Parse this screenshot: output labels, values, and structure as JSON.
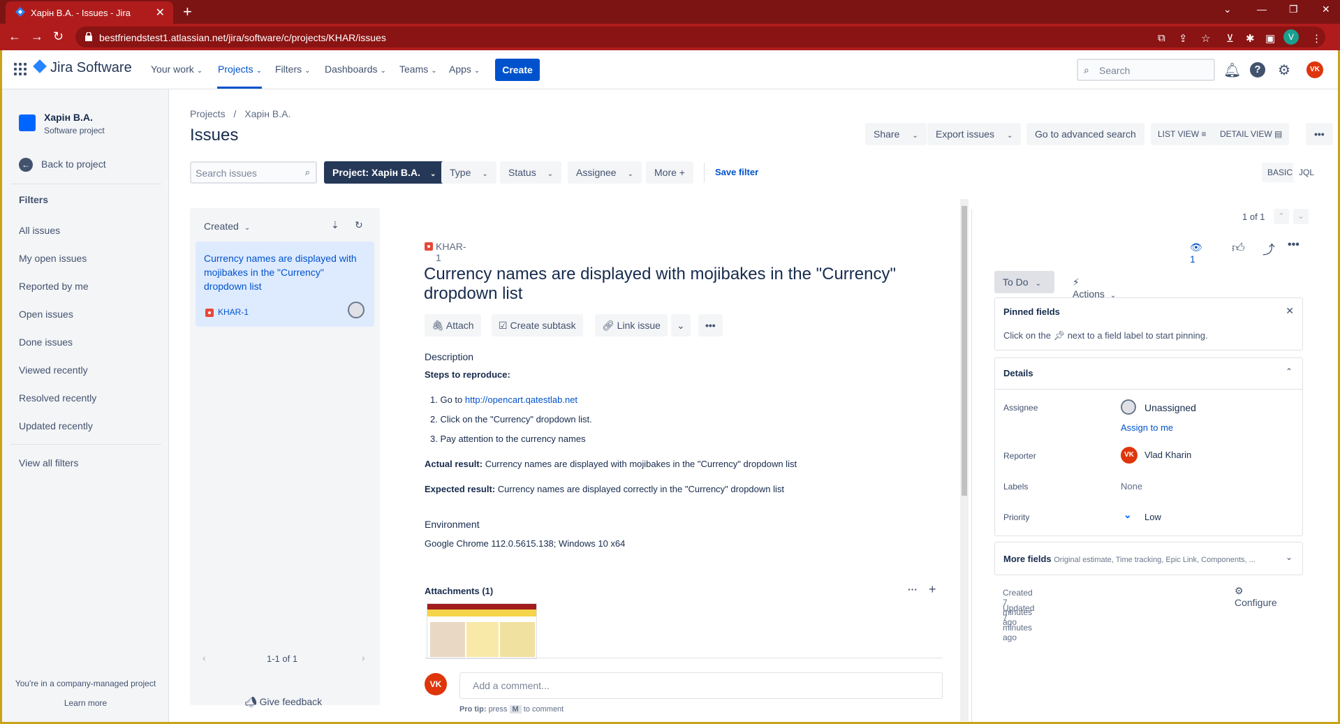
{
  "browser": {
    "tab_title": "Харін В.А. - Issues - Jira",
    "url": "bestfriendstest1.atlassian.net/jira/software/c/projects/KHAR/issues",
    "profile_initial": "V",
    "accent": "#b01c1c"
  },
  "topnav": {
    "logo": "Jira Software",
    "items": [
      "Your work",
      "Projects",
      "Filters",
      "Dashboards",
      "Teams",
      "Apps"
    ],
    "create": "Create",
    "search_placeholder": "Search",
    "user_initials": "VK"
  },
  "sidebar": {
    "project_name": "Харін В.А.",
    "project_type": "Software project",
    "back": "Back to project",
    "filters_heading": "Filters",
    "filters": [
      "All issues",
      "My open issues",
      "Reported by me",
      "Open issues",
      "Done issues",
      "Viewed recently",
      "Resolved recently",
      "Updated recently"
    ],
    "view_all": "View all filters",
    "footer_text": "You're in a company-managed project",
    "learn_more": "Learn more"
  },
  "header": {
    "breadcrumb_root": "Projects",
    "breadcrumb_sep": "/",
    "breadcrumb_project": "Харін В.А.",
    "title": "Issues",
    "share": "Share",
    "export": "Export issues",
    "advanced": "Go to advanced search",
    "list_view": "LIST VIEW",
    "detail_view": "DETAIL VIEW",
    "more": "•••"
  },
  "filterbar": {
    "search_placeholder": "Search issues",
    "project": "Project: Харін В.А.",
    "type": "Type",
    "status": "Status",
    "assignee": "Assignee",
    "more": "More",
    "save": "Save filter",
    "basic": "BASIC",
    "jql": "JQL"
  },
  "list": {
    "sort": "Created",
    "card_title": "Currency names are displayed with mojibakes in the \"Currency\" dropdown list",
    "card_key": "KHAR-1",
    "pagination": "1-1 of 1",
    "feedback": "Give feedback",
    "position": "1 of 1"
  },
  "issue": {
    "key": "KHAR-1",
    "title": "Currency names are displayed with mojibakes in the \"Currency\" dropdown list",
    "attach": "Attach",
    "subtask": "Create subtask",
    "link": "Link issue",
    "description_label": "Description",
    "steps_label": "Steps to reproduce:",
    "step1_prefix": "1. Go to ",
    "step1_link": "http://opencart.qatestlab.net",
    "step2": "2. Click on the \"Currency\" dropdown list.",
    "step3": "3. Pay attention to the currency names",
    "actual_label": "Actual result:",
    "actual_text": " Currency names are displayed with mojibakes in the \"Currency\" dropdown list",
    "expected_label": "Expected result:",
    "expected_text": " Currency names are displayed correctly in the \"Currency\" dropdown list",
    "environment_label": "Environment",
    "environment": "Google Chrome 112.0.5615.138; Windows 10 x64",
    "attachments": "Attachments (1)",
    "comment_placeholder": "Add a comment...",
    "protip_label": "Pro tip:",
    "protip_press": "press",
    "protip_key": "M",
    "protip_rest": "to comment"
  },
  "panel": {
    "watchers": "1",
    "status": "To Do",
    "actions": "Actions",
    "pinned_title": "Pinned fields",
    "pinned_hint_a": "Click on the",
    "pinned_hint_b": "next to a field label to start pinning.",
    "details": "Details",
    "assignee_label": "Assignee",
    "assignee": "Unassigned",
    "assign_me": "Assign to me",
    "reporter_label": "Reporter",
    "reporter": "Vlad Kharin",
    "labels_label": "Labels",
    "labels": "None",
    "priority_label": "Priority",
    "priority": "Low",
    "more_fields": "More fields",
    "more_fields_hint": "Original estimate, Time tracking, Epic Link, Components, ...",
    "created": "Created 7 minutes ago",
    "updated": "Updated 7 minutes ago",
    "configure": "Configure"
  }
}
